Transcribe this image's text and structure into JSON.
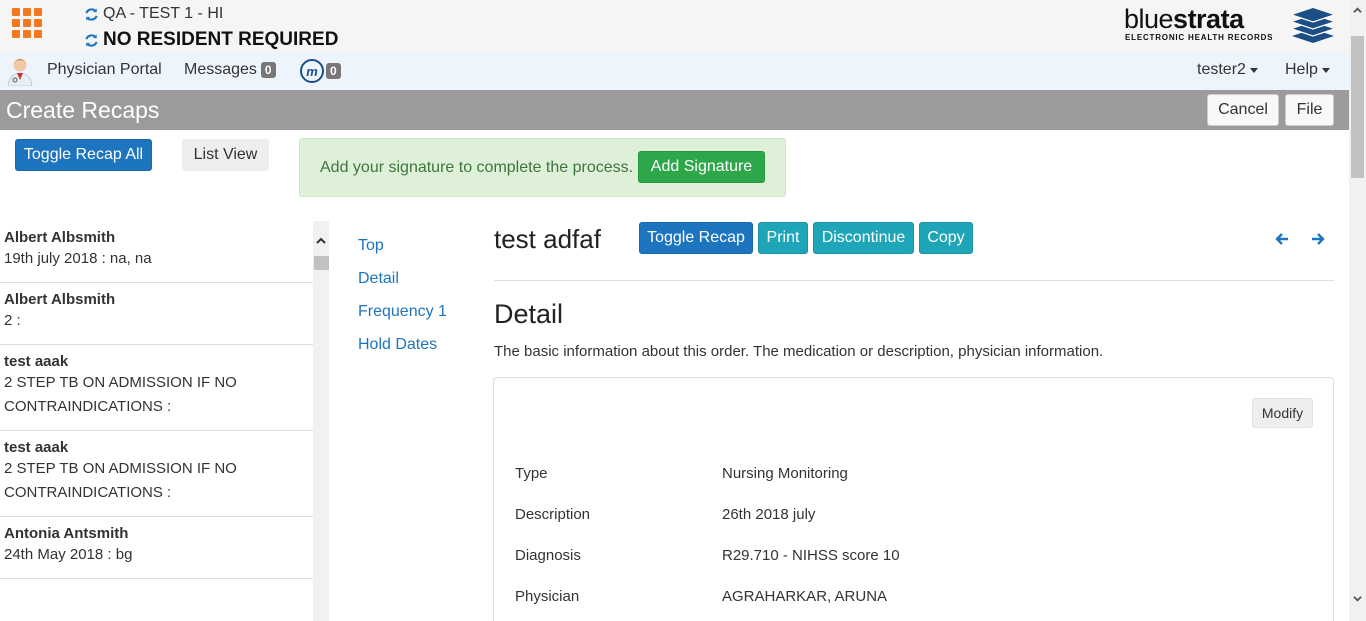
{
  "header": {
    "facility": "QA - TEST 1 - HI",
    "resident": "NO RESIDENT REQUIRED",
    "logo_light": "blue",
    "logo_bold": "strata",
    "logo_sub": "ELECTRONIC HEALTH RECORDS"
  },
  "nav": {
    "physician_portal": "Physician Portal",
    "messages_label": "Messages",
    "messages_count": "0",
    "m_icon_letter": "m",
    "m_count": "0",
    "user": "tester2",
    "help": "Help"
  },
  "titlebar": {
    "title": "Create Recaps",
    "cancel": "Cancel",
    "file": "File"
  },
  "actions": {
    "toggle_all": "Toggle Recap All",
    "list_view": "List View",
    "alert_text": "Add your signature to complete the process.",
    "add_signature": "Add Signature"
  },
  "list": {
    "items": [
      {
        "name": "Albert Albsmith",
        "sub": "19th july 2018 : na, na"
      },
      {
        "name": "Albert Albsmith",
        "sub": "2 :"
      },
      {
        "name": "test aaak",
        "sub": "2 STEP TB ON ADMISSION IF NO CONTRAINDICATIONS :"
      },
      {
        "name": "test aaak",
        "sub": "2 STEP TB ON ADMISSION IF NO CONTRAINDICATIONS :"
      },
      {
        "name": "Antonia Antsmith",
        "sub": "24th May 2018 : bg"
      }
    ]
  },
  "toc": {
    "items": [
      "Top",
      "Detail",
      "Frequency 1",
      "Hold Dates"
    ]
  },
  "order": {
    "title": "test adfaf",
    "toggle": "Toggle Recap",
    "print": "Print",
    "discontinue": "Discontinue",
    "copy": "Copy"
  },
  "detail": {
    "heading": "Detail",
    "description": "The basic information about this order. The medication or description, physician information.",
    "modify": "Modify",
    "fields": [
      {
        "label": "Type",
        "value": "Nursing Monitoring"
      },
      {
        "label": "Description",
        "value": "26th 2018 july"
      },
      {
        "label": "Diagnosis",
        "value": "R29.710 - NIHSS score 10"
      },
      {
        "label": "Physician",
        "value": "AGRAHARKAR, ARUNA"
      }
    ]
  },
  "colors": {
    "primary": "#1d74bf",
    "info": "#1fa5b8",
    "success": "#2ea74a",
    "grid_icon": "#f5781f",
    "titlebar": "#9b9b9b"
  }
}
